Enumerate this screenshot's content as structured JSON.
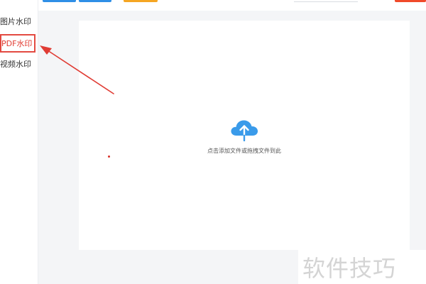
{
  "sidebar": {
    "items": [
      {
        "label": "图片水印",
        "selected": false
      },
      {
        "label": "PDF水印",
        "selected": true
      },
      {
        "label": "视频水印",
        "selected": false
      }
    ]
  },
  "upload": {
    "hint": "点击添加文件或拖拽文件到此",
    "icon": "cloud-upload-icon"
  },
  "watermark_text": "软件技巧",
  "colors": {
    "accent_blue": "#2f8fe6",
    "accent_orange": "#f5a623",
    "accent_red": "#f04a2a",
    "highlight_red": "#e34a41",
    "upload_icon": "#3a9bea",
    "main_bg": "#f4f5f7"
  }
}
